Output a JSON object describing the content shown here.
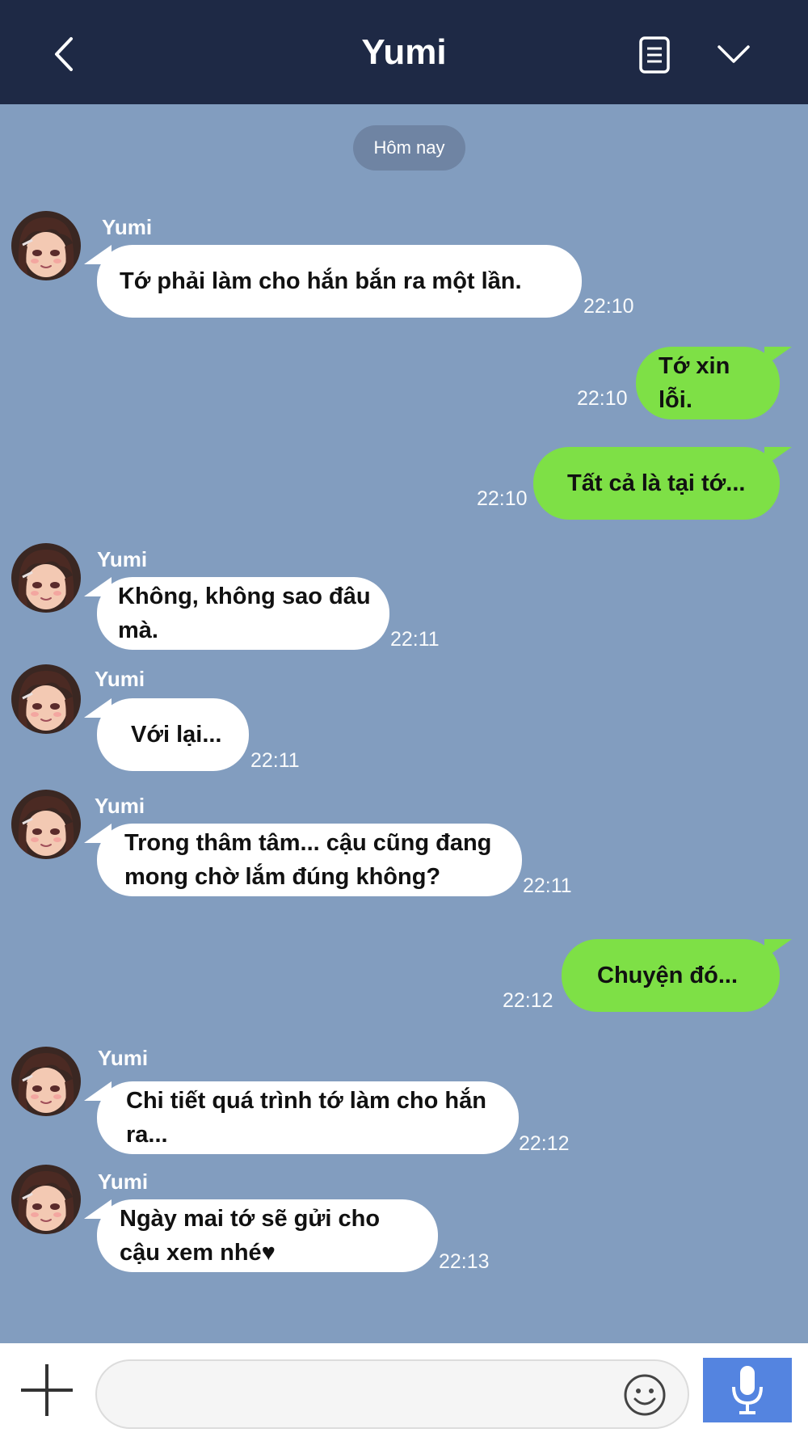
{
  "header": {
    "title": "Yumi"
  },
  "chat": {
    "date_label": "Hôm nay",
    "messages": [
      {
        "direction": "in",
        "sender": "Yumi",
        "text": "Tớ phải làm cho hắn bắn ra một lần.",
        "time": "22:10"
      },
      {
        "direction": "out",
        "text": "Tớ xin lỗi.",
        "time": "22:10"
      },
      {
        "direction": "out",
        "text": "Tất cả là tại tớ...",
        "time": "22:10"
      },
      {
        "direction": "in",
        "sender": "Yumi",
        "text": "Không, không sao đâu mà.",
        "time": "22:11"
      },
      {
        "direction": "in",
        "sender": "Yumi",
        "text": "Với lại...",
        "time": "22:11"
      },
      {
        "direction": "in",
        "sender": "Yumi",
        "text": "Trong thâm tâm... cậu cũng đang mong chờ lắm đúng không?",
        "time": "22:11"
      },
      {
        "direction": "out",
        "text": "Chuyện đó...",
        "time": "22:12"
      },
      {
        "direction": "in",
        "sender": "Yumi",
        "text": "Chi tiết quá trình tớ làm cho hắn ra...",
        "time": "22:12"
      },
      {
        "direction": "in",
        "sender": "Yumi",
        "text": "Ngày mai tớ sẽ gửi cho cậu xem nhé♥",
        "time": "22:13"
      }
    ]
  },
  "input": {
    "placeholder": ""
  },
  "colors": {
    "header_bg": "#1e2945",
    "chat_bg": "#829dbf",
    "incoming_bubble": "#ffffff",
    "outgoing_bubble": "#7ee046",
    "mic_button": "#5484e0"
  },
  "icons": [
    "back-arrow-icon",
    "notes-icon",
    "chevron-down-icon",
    "plus-icon",
    "smiley-icon",
    "microphone-icon"
  ]
}
